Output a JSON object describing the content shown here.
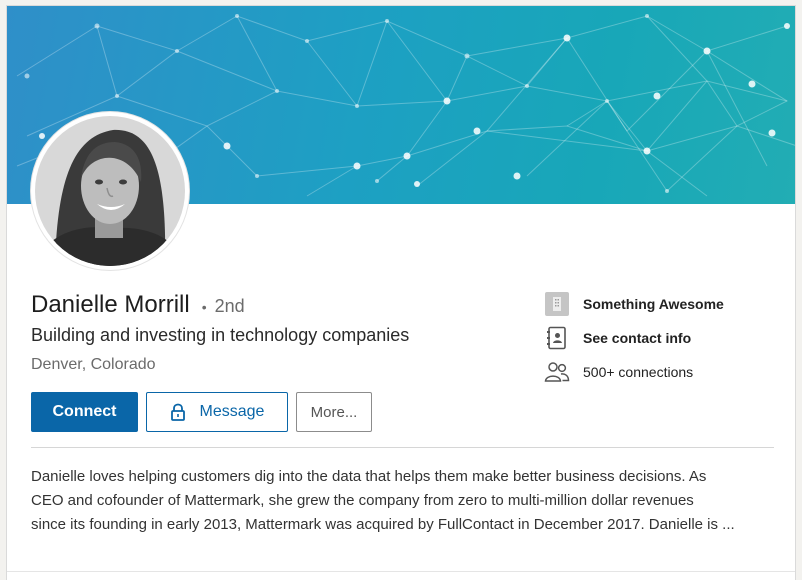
{
  "profile": {
    "name": "Danielle Morrill",
    "degree_separator": "•",
    "degree": "2nd",
    "headline": "Building and investing in technology companies",
    "location": "Denver, Colorado",
    "summary": "Danielle loves helping customers dig into the data that helps them make better business decisions. As\nCEO and cofounder of Mattermark, she grew the company from zero to multi-million dollar revenues\nsince its founding in early 2013, Mattermark was acquired by FullContact in December 2017. Danielle is ..."
  },
  "actions": {
    "connect_label": "Connect",
    "message_label": "Message",
    "more_label": "More..."
  },
  "side_info": {
    "company": {
      "label": "Something Awesome",
      "icon": "company-building-icon"
    },
    "contact": {
      "label": "See contact info",
      "icon": "contact-card-icon"
    },
    "connections": {
      "label": "500+ connections",
      "icon": "people-icon"
    }
  },
  "colors": {
    "primary": "#0a66a8",
    "banner_start": "#2f8fc9",
    "banner_end": "#22adb4"
  }
}
